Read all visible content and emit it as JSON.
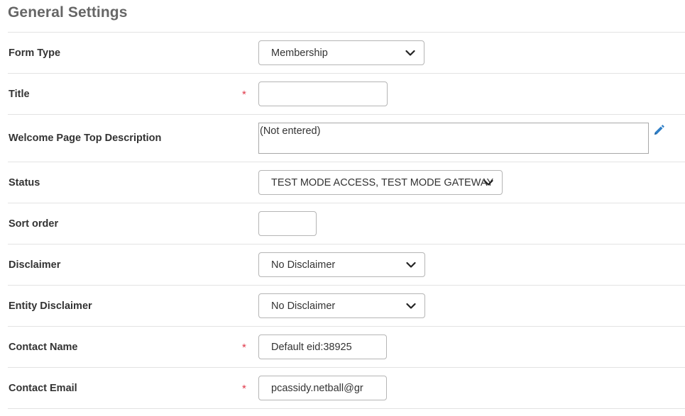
{
  "page": {
    "title": "General Settings"
  },
  "fields": {
    "form_type": {
      "label": "Form Type",
      "value": "Membership"
    },
    "title": {
      "label": "Title",
      "required_mark": "*",
      "value": ""
    },
    "welcome_desc": {
      "label": "Welcome Page Top Description",
      "value": "(Not entered)",
      "edit_icon": "pencil-icon"
    },
    "status": {
      "label": "Status",
      "value": "TEST MODE ACCESS, TEST MODE GATEWAY"
    },
    "sort_order": {
      "label": "Sort order",
      "value": ""
    },
    "disclaimer": {
      "label": "Disclaimer",
      "value": "No Disclaimer"
    },
    "entity_disclaimer": {
      "label": "Entity Disclaimer",
      "value": "No Disclaimer"
    },
    "contact_name": {
      "label": "Contact Name",
      "required_mark": "*",
      "value": "Default eid:38925"
    },
    "contact_email": {
      "label": "Contact Email",
      "required_mark": "*",
      "value": "pcassidy.netball@gr"
    }
  },
  "colors": {
    "title": "#666666",
    "label": "#333333",
    "required": "#e0394a",
    "border": "#b5b5b5",
    "divider": "#e3e3e3",
    "edit_icon": "#2f7fc7"
  }
}
